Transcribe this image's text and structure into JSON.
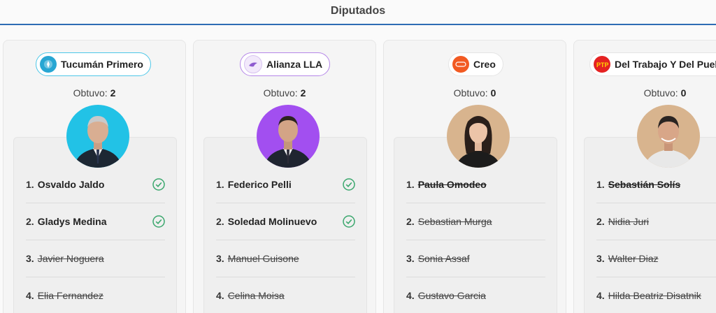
{
  "header": {
    "title": "Diputados"
  },
  "colors": {
    "accent": "#2e6db4",
    "check": "#3aa76d"
  },
  "parties": [
    {
      "name": "Tucumán Primero",
      "logo_icon": "tucuman-primero-logo",
      "pill_border": "#4cc7e8",
      "logo_color": "#27a6d3",
      "obtuvo_label": "Obtuvo:",
      "obtuvo_value": "2",
      "avatar_bg": "#22c2e6",
      "candidates": [
        {
          "num": "1.",
          "name": "Osvaldo Jaldo",
          "status": "elected"
        },
        {
          "num": "2.",
          "name": "Gladys Medina",
          "status": "elected"
        },
        {
          "num": "3.",
          "name": "Javier Noguera",
          "status": "out"
        },
        {
          "num": "4.",
          "name": "Elia Fernandez",
          "status": "out"
        }
      ]
    },
    {
      "name": "Alianza LLA",
      "logo_icon": "lla-lion-logo",
      "pill_border": "#b586e8",
      "logo_color": "#f2e9fb",
      "obtuvo_label": "Obtuvo:",
      "obtuvo_value": "2",
      "avatar_bg": "#a24ff0",
      "candidates": [
        {
          "num": "1.",
          "name": "Federico Pelli",
          "status": "elected"
        },
        {
          "num": "2.",
          "name": "Soledad Molinuevo",
          "status": "elected"
        },
        {
          "num": "3.",
          "name": "Manuel Guisone",
          "status": "out"
        },
        {
          "num": "4.",
          "name": "Celina Moisa",
          "status": "out"
        }
      ]
    },
    {
      "name": "Creo",
      "logo_icon": "creo-logo",
      "pill_border": "#e5e5e5",
      "logo_color": "#f25a22",
      "obtuvo_label": "Obtuvo:",
      "obtuvo_value": "0",
      "avatar_bg": "#d8b48e",
      "candidates": [
        {
          "num": "1.",
          "name": "Paula Omodeo",
          "status": "out"
        },
        {
          "num": "2.",
          "name": "Sebastian Murga",
          "status": "out"
        },
        {
          "num": "3.",
          "name": "Sonia Assaf",
          "status": "out"
        },
        {
          "num": "4.",
          "name": "Gustavo Garcia",
          "status": "out"
        }
      ]
    },
    {
      "name": "Del Trabajo Y Del Pueblo",
      "logo_icon": "ptp-logo",
      "pill_border": "#e5e5e5",
      "logo_color": "#e52222",
      "obtuvo_label": "Obtuvo:",
      "obtuvo_value": "0",
      "avatar_bg": "#d8b48e",
      "candidates": [
        {
          "num": "1.",
          "name": "Sebastián Solís",
          "status": "out"
        },
        {
          "num": "2.",
          "name": "Nidia Juri",
          "status": "out"
        },
        {
          "num": "3.",
          "name": "Walter Diaz",
          "status": "out"
        },
        {
          "num": "4.",
          "name": "Hilda Beatriz Disatnik",
          "status": "out"
        }
      ]
    }
  ]
}
